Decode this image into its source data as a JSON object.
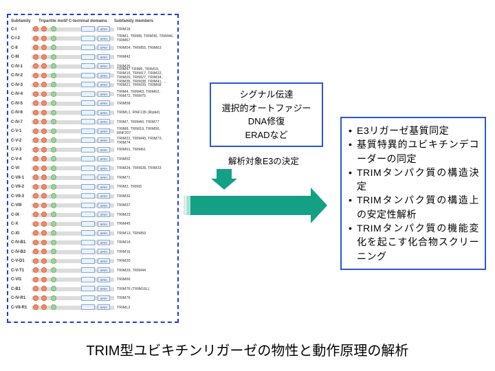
{
  "panel": {
    "headers": {
      "subfamily": "Subfamily",
      "motif": "Tripartite motif    C-terminal domains",
      "members": "Subfamily members"
    },
    "rows": [
      {
        "sub": "C-I",
        "members": "TRIM18"
      },
      {
        "sub": "C-I  2",
        "members": "TRIM1, TRIM9, TRIM36, TRIM46, TRIM67"
      },
      {
        "sub": "C-II",
        "members": "TRIM54, TRIM55, TRIM63"
      },
      {
        "sub": "C-III",
        "members": "TRIM42"
      },
      {
        "sub": "C-IV-1",
        "members": "TRIM25"
      },
      {
        "sub": "C-IV-2",
        "members": "TRIM47 TRIM6, TRIM10, TRIM15, TRIM17, TRIM22, TRIM26, TRIM27, TRIM34, TRIM35, TRIM38, TRIM41, ..."
      },
      {
        "sub": "C-IV-3",
        "members": "TRIM21, TRIM39, TRIM68"
      },
      {
        "sub": "C-IV-4",
        "members": "TRIM4, TRIM43, TRIM62, TRIM72, TRIM75"
      },
      {
        "sub": "C-IV-5",
        "members": "TRIM58"
      },
      {
        "sub": "C-IV-6",
        "members": "TRIML1, RNF135 (Riplet)"
      },
      {
        "sub": "C-IV-7",
        "members": "TRIM7, TRIM40, TRIM77"
      },
      {
        "sub": "C-V-1",
        "members": "TRIM8, TRIM19, TRIM56, RNF207"
      },
      {
        "sub": "C-V-2",
        "members": "TRIM31, TRIM40, TRIM73, TRIM74"
      },
      {
        "sub": "C-V-3",
        "members": "TRIM61, TRIM61"
      },
      {
        "sub": "C-V-4",
        "members": "TRIM52"
      },
      {
        "sub": "C-VI",
        "members": "TRIM24, TRIM28, TRIM33"
      },
      {
        "sub": "C-VII-1",
        "members": "TRIM71"
      },
      {
        "sub": "C-VII-2",
        "members": "TRIM2, TRIM3"
      },
      {
        "sub": "C-VII-3",
        "members": "TRIM32"
      },
      {
        "sub": "C-VIII",
        "members": "TRIM37"
      },
      {
        "sub": "C-IX",
        "members": "TRIM23"
      },
      {
        "sub": "C-X",
        "members": "TRIM45"
      },
      {
        "sub": "C-XI",
        "members": "TRIM13, TRIM59"
      },
      {
        "sub": "C-IV-B1",
        "members": "TRIM14"
      },
      {
        "sub": "C-IV-B2",
        "members": "TRIM16"
      },
      {
        "sub": "C-V-D1",
        "members": "TRIM20"
      },
      {
        "sub": "C-V-T1",
        "members": "TRIM29, TRIM44"
      },
      {
        "sub": "C-VI1",
        "members": "TRIM66"
      },
      {
        "sub": "C-B1",
        "members": "TRIM76 (TRIM16L)"
      },
      {
        "sub": "C-IV-R1",
        "members": "TRIM76"
      },
      {
        "sub": "C-VII-R1",
        "members": "TRIML2"
      }
    ]
  },
  "topBox": {
    "l1": "シグナル伝達",
    "l2": "選択的オートファジー",
    "l3": "DNA修復",
    "l4": "ERADなど"
  },
  "decisionLabel": "解析対象E3の決定",
  "rightBox": {
    "items": [
      "E3リガーゼ基質同定",
      "基質特異的ユビキチンデコーダーの同定",
      "TRIMタンパク質の構造決定",
      "TRIMタンパク質の構造上の安定性解析",
      "TRIMタンパク質の機能変化を起こす化合物スクリーニング"
    ]
  },
  "title": "TRIM型ユビキチンリガーゼの物性と動作原理の解析"
}
